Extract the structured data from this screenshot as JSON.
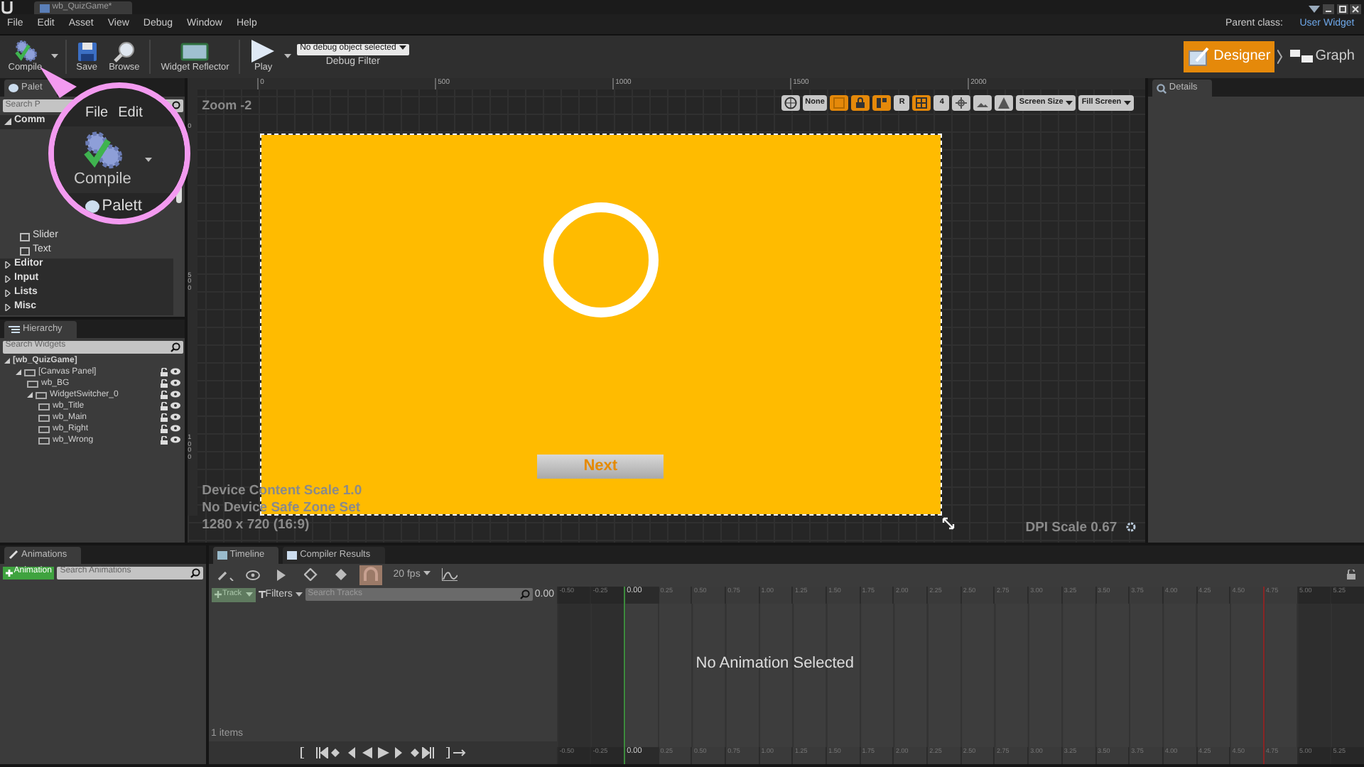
{
  "window": {
    "tab_title": "wb_QuizGame*"
  },
  "menu": [
    "File",
    "Edit",
    "Asset",
    "View",
    "Debug",
    "Window",
    "Help"
  ],
  "parent_class": {
    "label": "Parent class:",
    "value": "User Widget"
  },
  "toolbar": [
    {
      "kind": "compile",
      "label": "Compile",
      "caret": true
    },
    {
      "kind": "save",
      "label": "Save",
      "caret": false
    },
    {
      "kind": "browse",
      "label": "Browse",
      "caret": false
    },
    {
      "kind": "reflector",
      "label": "Widget Reflector",
      "caret": false
    },
    {
      "kind": "play",
      "label": "Play",
      "caret": true
    }
  ],
  "debug_filter": {
    "value": "No debug object selected",
    "label": "Debug Filter"
  },
  "modes": [
    {
      "label": "Designer",
      "selected": true
    },
    {
      "label": "Graph",
      "selected": false
    }
  ],
  "palette": {
    "tab": "Palet",
    "search_placeholder": "Search P",
    "groups": [
      {
        "label": "Comm",
        "expanded": true,
        "children": [
          {
            "label": "Slider"
          },
          {
            "label": "Text"
          }
        ]
      },
      {
        "label": "Editor",
        "expanded": false
      },
      {
        "label": "Input",
        "expanded": false
      },
      {
        "label": "Lists",
        "expanded": false
      },
      {
        "label": "Misc",
        "expanded": false
      }
    ]
  },
  "callout": {
    "menu": [
      "File",
      "Edit"
    ],
    "button": "Compile",
    "tab": "Palett"
  },
  "hierarchy": {
    "tab": "Hierarchy",
    "search_placeholder": "Search Widgets",
    "tree": [
      {
        "label": "[wb_QuizGame]",
        "children": [
          {
            "label": "[Canvas Panel]",
            "children": [
              {
                "label": "wb_BG"
              },
              {
                "label": "WidgetSwitcher_0",
                "children": [
                  {
                    "label": "wb_Title"
                  },
                  {
                    "label": "wb_Main"
                  },
                  {
                    "label": "wb_Right"
                  },
                  {
                    "label": "wb_Wrong"
                  }
                ]
              }
            ]
          }
        ]
      }
    ]
  },
  "viewport": {
    "zoom": "Zoom -2",
    "ruler": [
      "0",
      "500",
      "1000",
      "1500",
      "2000"
    ],
    "side_ruler": [
      "0",
      "500",
      "1000"
    ],
    "options": [
      {
        "kind": "globe",
        "on": false
      },
      {
        "kind": "label",
        "label": "None",
        "on": false
      },
      {
        "kind": "outline",
        "on": true
      },
      {
        "kind": "lock",
        "on": true
      },
      {
        "kind": "layout",
        "on": true
      },
      {
        "kind": "label",
        "label": "R",
        "on": false
      },
      {
        "kind": "grid",
        "on": true
      },
      {
        "kind": "label",
        "label": "4",
        "on": false
      },
      {
        "kind": "move",
        "on": false
      },
      {
        "kind": "image",
        "on": false
      },
      {
        "kind": "warn",
        "on": false
      },
      {
        "kind": "dropdown",
        "label": "Screen Size",
        "on": false
      },
      {
        "kind": "dropdown",
        "label": "Fill Screen",
        "on": false
      }
    ],
    "surface": {
      "button": "Next"
    },
    "info": [
      "Device Content Scale 1.0",
      "No Device Safe Zone Set",
      "1280 x 720 (16:9)"
    ],
    "dpi": "DPI Scale 0.67"
  },
  "details": {
    "tab": "Details"
  },
  "animations": {
    "tab": "Animations",
    "add": "Animation",
    "search_placeholder": "Search Animations"
  },
  "timeline_tabs": [
    {
      "label": "Timeline",
      "selected": true
    },
    {
      "label": "Compiler Results",
      "selected": false
    }
  ],
  "timeline": {
    "fps": "20 fps",
    "track": "Track",
    "filters": "Filters",
    "search_placeholder": "Search Tracks",
    "time": "0.00",
    "count": "1 items",
    "empty": "No Animation Selected",
    "ruler_top": {
      "before": [
        {
          "label": "-0.50",
          "in_range": false
        },
        {
          "label": "-0.25",
          "in_range": false
        }
      ],
      "playhead": "0.00",
      "after": [
        {
          "label": "0.25",
          "in_range": true
        },
        {
          "label": "0.50",
          "in_range": true
        },
        {
          "label": "0.75",
          "in_range": true
        },
        {
          "label": "1.00",
          "in_range": true
        },
        {
          "label": "1.25",
          "in_range": true
        },
        {
          "label": "1.50",
          "in_range": true
        },
        {
          "label": "1.75",
          "in_range": true
        },
        {
          "label": "2.00",
          "in_range": true
        },
        {
          "label": "2.25",
          "in_range": true
        },
        {
          "label": "2.50",
          "in_range": true
        },
        {
          "label": "2.75",
          "in_range": true
        },
        {
          "label": "3.00",
          "in_range": true
        },
        {
          "label": "3.25",
          "in_range": true
        },
        {
          "label": "3.50",
          "in_range": true
        },
        {
          "label": "3.75",
          "in_range": true
        },
        {
          "label": "4.00",
          "in_range": true
        },
        {
          "label": "4.25",
          "in_range": true
        },
        {
          "label": "4.50",
          "in_range": true
        },
        {
          "label": "4.75",
          "in_range": true
        },
        {
          "label": "5.00",
          "in_range": false
        },
        {
          "label": "5.25",
          "in_range": false
        }
      ]
    },
    "ruler_bottom": {
      "before": [
        {
          "label": "-0.50",
          "in_range": false
        },
        {
          "label": "-0.25",
          "in_range": false
        }
      ],
      "playhead": "0.00",
      "after": [
        {
          "label": "0.25",
          "in_range": true
        },
        {
          "label": "0.50",
          "in_range": true
        },
        {
          "label": "0.75",
          "in_range": true
        },
        {
          "label": "1.00",
          "in_range": true
        },
        {
          "label": "1.25",
          "in_range": true
        },
        {
          "label": "1.50",
          "in_range": true
        },
        {
          "label": "1.75",
          "in_range": true
        },
        {
          "label": "2.00",
          "in_range": true
        },
        {
          "label": "2.25",
          "in_range": true
        },
        {
          "label": "2.50",
          "in_range": true
        },
        {
          "label": "2.75",
          "in_range": true
        },
        {
          "label": "3.00",
          "in_range": true
        },
        {
          "label": "3.25",
          "in_range": true
        },
        {
          "label": "3.50",
          "in_range": true
        },
        {
          "label": "3.75",
          "in_range": true
        },
        {
          "label": "4.00",
          "in_range": true
        },
        {
          "label": "4.25",
          "in_range": true
        },
        {
          "label": "4.50",
          "in_range": true
        },
        {
          "label": "4.75",
          "in_range": true
        },
        {
          "label": "5.00",
          "in_range": false
        },
        {
          "label": "5.25",
          "in_range": false
        }
      ]
    }
  }
}
